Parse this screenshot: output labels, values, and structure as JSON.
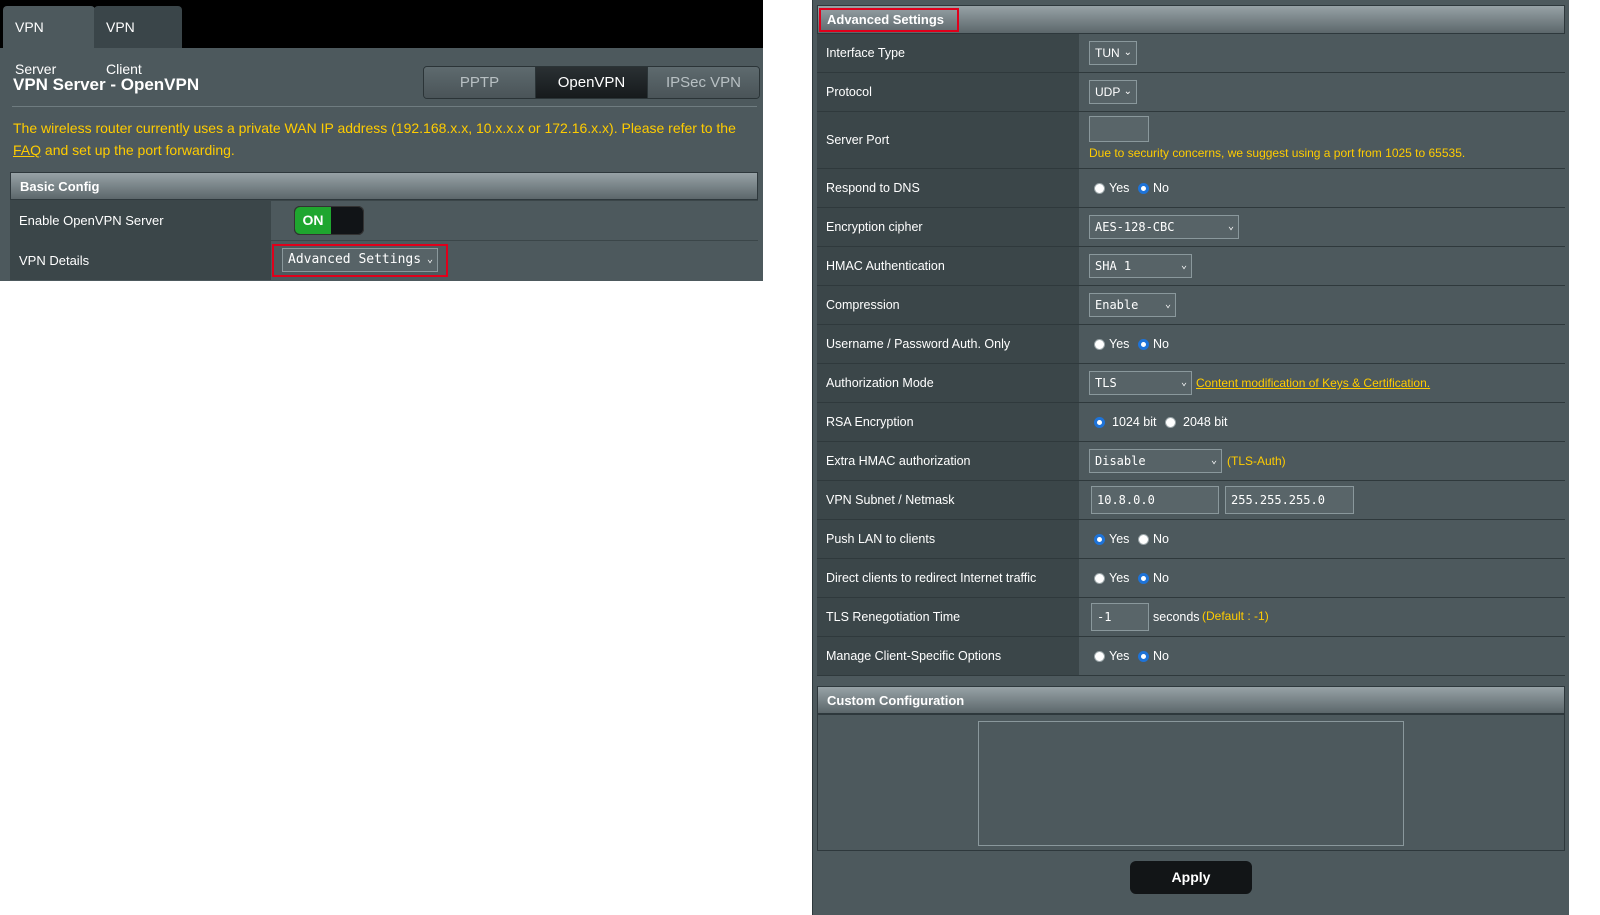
{
  "left": {
    "tabs": [
      "VPN Server",
      "VPN Client"
    ],
    "page_title": "VPN Server - OpenVPN",
    "protocol_tabs": [
      "PPTP",
      "OpenVPN",
      "IPSec VPN"
    ],
    "active_protocol": "OpenVPN",
    "notice": {
      "before_link": "The wireless router currently uses a private WAN IP address (192.168.x.x, 10.x.x.x or 172.16.x.x). Please refer to the ",
      "link": "FAQ",
      "after_link": " and set up the port forwarding."
    },
    "basic_config": {
      "header": "Basic Config",
      "enable_label": "Enable OpenVPN Server",
      "toggle_on": "ON",
      "vpn_details_label": "VPN Details",
      "vpn_details_value": "Advanced Settings"
    }
  },
  "right": {
    "header": "Advanced Settings",
    "rows": {
      "interface_type": {
        "label": "Interface Type",
        "value": "TUN"
      },
      "protocol": {
        "label": "Protocol",
        "value": "UDP"
      },
      "server_port": {
        "label": "Server Port",
        "value": "",
        "hint": "Due to security concerns, we suggest using a port from 1025 to 65535."
      },
      "respond_dns": {
        "label": "Respond to DNS",
        "yes": "Yes",
        "no": "No"
      },
      "cipher": {
        "label": "Encryption cipher",
        "value": "AES-128-CBC"
      },
      "hmac": {
        "label": "HMAC Authentication",
        "value": "SHA 1"
      },
      "compression": {
        "label": "Compression",
        "value": "Enable"
      },
      "userpass": {
        "label": "Username / Password Auth. Only",
        "yes": "Yes",
        "no": "No"
      },
      "auth_mode": {
        "label": "Authorization Mode",
        "value": "TLS",
        "link": "Content modification of Keys & Certification."
      },
      "rsa": {
        "label": "RSA Encryption",
        "opt1": "1024 bit",
        "opt2": "2048 bit"
      },
      "extra_hmac": {
        "label": "Extra HMAC authorization",
        "value": "Disable",
        "note": "(TLS-Auth)"
      },
      "subnet": {
        "label": "VPN Subnet / Netmask",
        "subnet": "10.8.0.0",
        "netmask": "255.255.255.0"
      },
      "push_lan": {
        "label": "Push LAN to clients",
        "yes": "Yes",
        "no": "No"
      },
      "redirect": {
        "label": "Direct clients to redirect Internet traffic",
        "yes": "Yes",
        "no": "No"
      },
      "tls_reneg": {
        "label": "TLS Renegotiation Time",
        "value": "-1",
        "unit": "seconds",
        "note": "(Default : -1)"
      },
      "client_specific": {
        "label": "Manage Client-Specific Options",
        "yes": "Yes",
        "no": "No"
      }
    },
    "custom_header": "Custom Configuration",
    "apply": "Apply"
  }
}
